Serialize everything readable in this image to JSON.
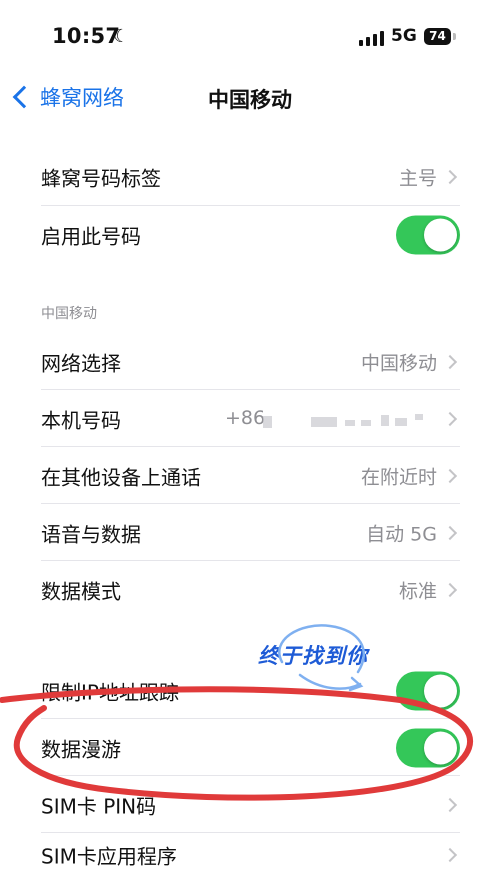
{
  "status": {
    "time": "10:57",
    "network": "5G",
    "battery": "74"
  },
  "nav": {
    "back_label": "蜂窝网络",
    "title": "中国移动"
  },
  "rows": {
    "cellular_label": {
      "label": "蜂窝号码标签",
      "value": "主号"
    },
    "enable_line": {
      "label": "启用此号码",
      "on": true
    },
    "section_header": "中国移动",
    "network_selection": {
      "label": "网络选择",
      "value": "中国移动"
    },
    "my_number": {
      "label": "本机号码",
      "value": "+86"
    },
    "calls_other_devices": {
      "label": "在其他设备上通话",
      "value": "在附近时"
    },
    "voice_data": {
      "label": "语音与数据",
      "value": "自动 5G"
    },
    "data_mode": {
      "label": "数据模式",
      "value": "标准"
    },
    "limit_ip_tracking": {
      "label": "限制IP地址跟踪",
      "on": true
    },
    "data_roaming": {
      "label": "数据漫游",
      "on": true
    },
    "sim_pin": {
      "label": "SIM卡 PIN码"
    },
    "sim_apps": {
      "label": "SIM卡应用程序"
    }
  },
  "annotation": {
    "text": "终于找到你",
    "color": "#1e5bd6",
    "circle_color": "#e03a3a"
  },
  "colors": {
    "accent": "#1a73e8",
    "toggle_on": "#34c759",
    "secondary_text": "#8e8e93"
  },
  "icons": {
    "moon": "moon-icon",
    "signal": "signal-icon",
    "battery": "battery-icon",
    "back": "chevron-left-icon",
    "disclosure": "chevron-right-icon"
  }
}
